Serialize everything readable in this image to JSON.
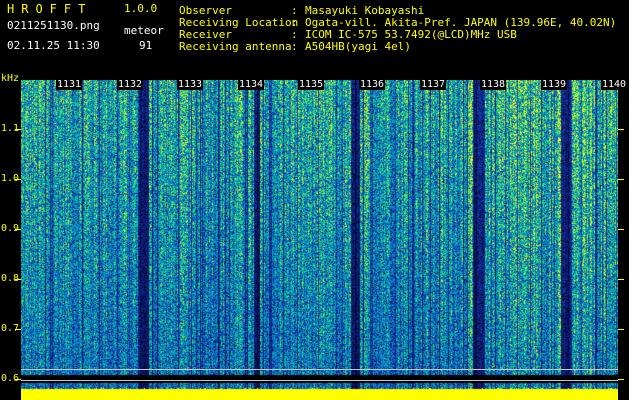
{
  "header": {
    "title": "HROFFT",
    "version": "1.0.0",
    "file": "0211251130.png",
    "meteor_label": "meteor",
    "datetime": "02.11.25 11:30",
    "meteor_count": "91"
  },
  "info": [
    {
      "label": "Observer",
      "value": "Masayuki Kobayashi"
    },
    {
      "label": "Receiving Location",
      "value": "Ogata-vill. Akita-Pref. JAPAN (139.96E, 40.02N)"
    },
    {
      "label": "Receiver",
      "value": "ICOM IC-575 53.7492(@LCD)MHz USB"
    },
    {
      "label": "Receiving antenna",
      "value": "A504HB(yagi 4el)"
    }
  ],
  "axis": {
    "unit": "kHz",
    "freq_ticks": [
      "1.1",
      "1.0",
      "0.9",
      "0.8",
      "0.7",
      "0.6"
    ],
    "time_ticks": [
      "1131",
      "1132",
      "1133",
      "1134",
      "1135",
      "1136",
      "1137",
      "1138",
      "1139",
      "1140"
    ]
  },
  "colors": {
    "text_yellow": "#ffff00",
    "text_white": "#ffffff",
    "background": "#000000",
    "spectrum_low": "#0a0f6e",
    "spectrum_mid": "#00c8a0",
    "spectrum_high": "#ffff00"
  }
}
